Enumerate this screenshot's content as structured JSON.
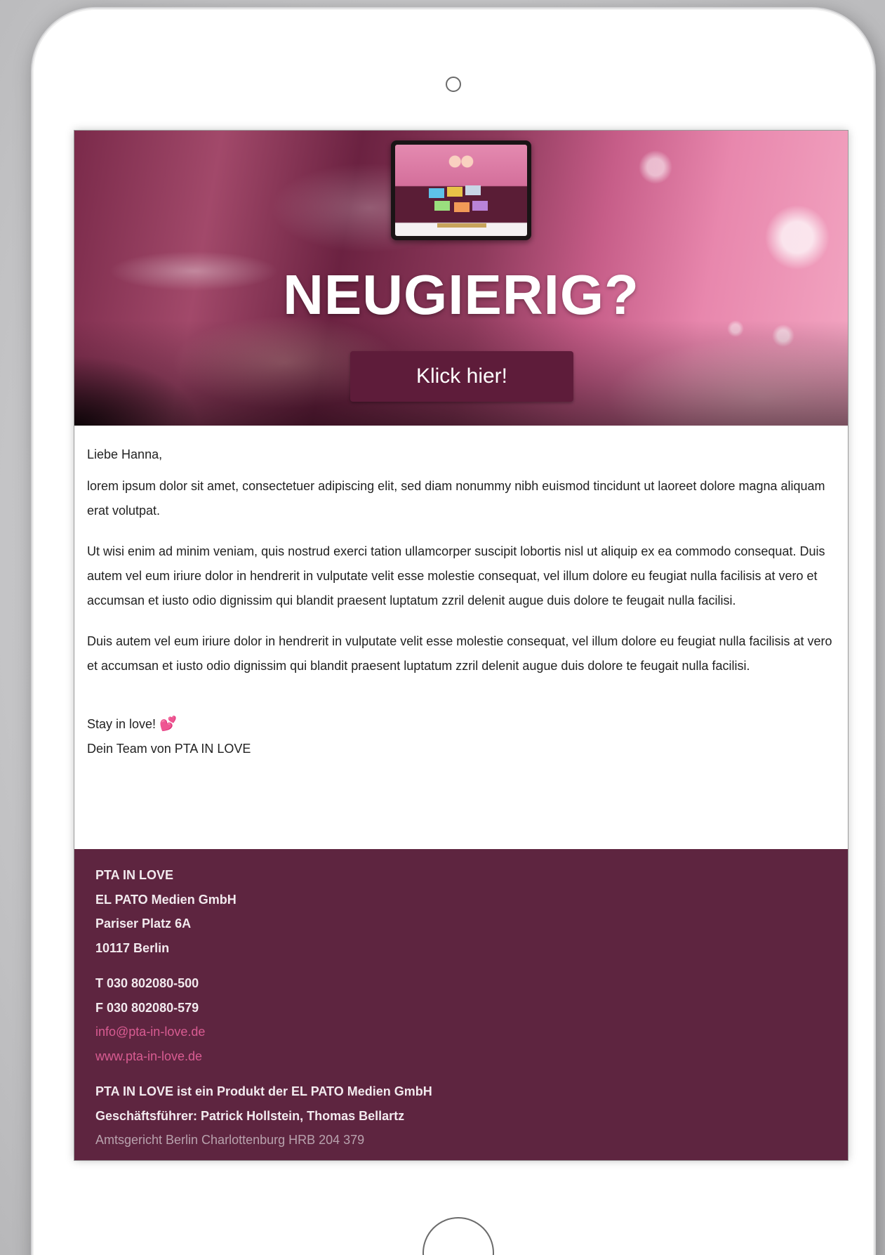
{
  "hero": {
    "title": "NEUGIERIG?",
    "button_label": "Klick hier!"
  },
  "letter": {
    "greeting": "Liebe Hanna,",
    "paragraphs": [
      "lorem ipsum dolor sit amet, consectetuer adipiscing elit, sed diam nonummy nibh euismod tincidunt ut laoreet dolore magna aliquam erat volutpat.",
      "Ut wisi enim ad minim veniam, quis nostrud exerci tation ullamcorper suscipit lobortis nisl ut aliquip ex ea commodo consequat. Duis autem vel eum iriure dolor in hendrerit in vulputate velit esse molestie consequat, vel illum dolore eu feugiat nulla facilisis at vero et accumsan et iusto odio dignissim qui blandit praesent luptatum zzril delenit augue duis dolore te feugait nulla facilisi.",
      "Duis autem vel eum iriure dolor in hendrerit in vulputate velit esse molestie consequat, vel illum dolore eu feugiat nulla facilisis at vero et accumsan et iusto odio dignissim qui blandit praesent luptatum zzril delenit augue duis dolore te feugait nulla facilisi."
    ],
    "sign_line_1": "Stay in love!",
    "sign_emoji": "💕",
    "sign_line_2": "Dein Team von PTA IN LOVE"
  },
  "footer": {
    "brand": "PTA IN LOVE",
    "company": "EL PATO Medien GmbH",
    "street": "Pariser Platz 6A",
    "city": "10117 Berlin",
    "phone": "T 030 802080-500",
    "fax": "F 030 802080-579",
    "email": "info@pta-in-love.de",
    "website": "www.pta-in-love.de",
    "product_note": "PTA IN LOVE ist ein Produkt der EL PATO Medien GmbH",
    "managers": "Geschäftsführer: Patrick Hollstein, Thomas Bellartz",
    "registry": "Amtsgericht Berlin Charlottenburg HRB 204 379"
  },
  "colors": {
    "brand_plum": "#5e2540",
    "button": "#5e1c3a",
    "link_pink": "#d95c92"
  }
}
